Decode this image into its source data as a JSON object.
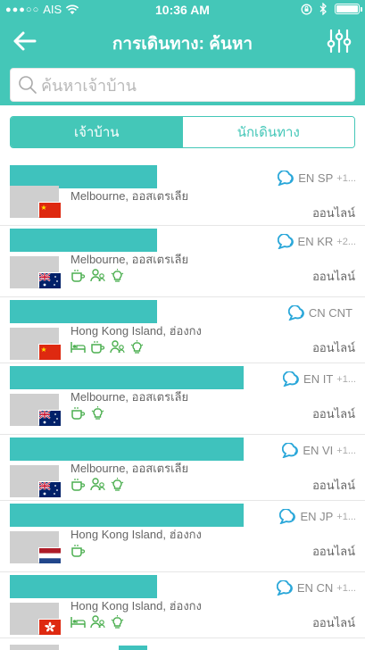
{
  "status_bar": {
    "carrier": "AIS",
    "time": "10:36 AM"
  },
  "nav": {
    "title": "การเดินทาง: ค้นหา"
  },
  "search": {
    "placeholder": "ค้นหาเจ้าบ้าน",
    "value": ""
  },
  "segments": {
    "hosts": "เจ้าบ้าน",
    "travelers": "นักเดินทาง",
    "active": "hosts"
  },
  "colors": {
    "accent": "#44c7b8",
    "namebar": "#3fc2bd",
    "amenity": "#4caf50"
  },
  "hosts": [
    {
      "location": "Melbourne, ออสเตรเลีย",
      "languages": "EN SP",
      "more": "+1...",
      "status": "ออนไลน์",
      "flag": "china-flag",
      "amenities": []
    },
    {
      "location": "Melbourne, ออสเตรเลีย",
      "languages": "EN KR",
      "more": "+2...",
      "status": "ออนไลน์",
      "flag": "australia-flag",
      "amenities": [
        "coffee-icon",
        "guide-icon",
        "lightbulb-icon"
      ]
    },
    {
      "location": "Hong Kong Island, ฮ่องกง",
      "languages": "CN CNT",
      "more": "",
      "status": "ออนไลน์",
      "flag": "china-flag",
      "amenities": [
        "bed-icon",
        "coffee-icon",
        "guide-icon",
        "lightbulb-icon"
      ]
    },
    {
      "location": "Melbourne, ออสเตรเลีย",
      "languages": "EN IT",
      "more": "+1...",
      "status": "ออนไลน์",
      "flag": "australia-flag",
      "amenities": [
        "coffee-icon",
        "lightbulb-icon"
      ]
    },
    {
      "location": "Melbourne, ออสเตรเลีย",
      "languages": "EN VI",
      "more": "+1...",
      "status": "ออนไลน์",
      "flag": "australia-flag",
      "amenities": [
        "coffee-icon",
        "guide-icon",
        "lightbulb-icon"
      ]
    },
    {
      "location": "Hong Kong Island, ฮ่องกง",
      "languages": "EN JP",
      "more": "+1...",
      "status": "ออนไลน์",
      "flag": "netherlands-flag",
      "amenities": [
        "coffee-icon"
      ]
    },
    {
      "location": "Hong Kong Island, ฮ่องกง",
      "languages": "EN CN",
      "more": "+1...",
      "status": "ออนไลน์",
      "flag": "hongkong-flag",
      "amenities": [
        "bed-icon",
        "guide-icon",
        "lightbulb-icon"
      ]
    }
  ]
}
